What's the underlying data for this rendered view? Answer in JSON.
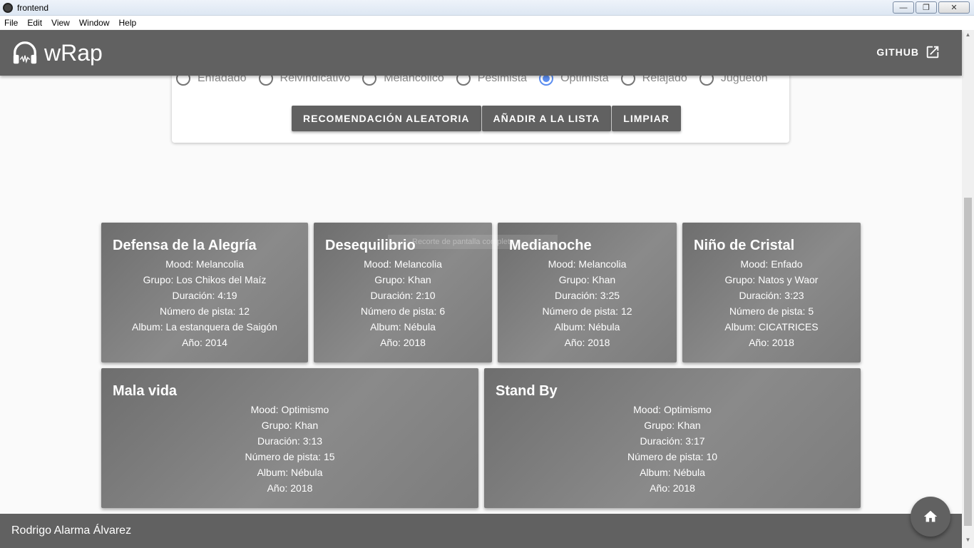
{
  "window": {
    "title": "frontend",
    "controls": [
      "minimize",
      "restore",
      "close"
    ]
  },
  "menu": [
    "File",
    "Edit",
    "View",
    "Window",
    "Help"
  ],
  "header": {
    "brand": "wRap",
    "github_label": "GITHUB"
  },
  "moods": [
    {
      "label": "Enfadado",
      "checked": false
    },
    {
      "label": "Reivindicativo",
      "checked": false
    },
    {
      "label": "Melancólico",
      "checked": false
    },
    {
      "label": "Pesimista",
      "checked": false
    },
    {
      "label": "Optimista",
      "checked": true
    },
    {
      "label": "Relajado",
      "checked": false
    },
    {
      "label": "Juguetón",
      "checked": false
    }
  ],
  "buttons": {
    "random": "RECOMENDACIÓN ALEATORIA",
    "add": "AÑADIR A LA LISTA",
    "clear": "LIMPIAR"
  },
  "songs": [
    {
      "title": "Defensa de la Alegría",
      "mood": "Mood: Melancolia",
      "group": "Grupo: Los Chikos del Maíz",
      "duration": "Duración: 4:19",
      "track": "Número de pista: 12",
      "album": "Album: La estanquera de Saigón",
      "year": "Año: 2014"
    },
    {
      "title": "Desequilibrio",
      "mood": "Mood: Melancolia",
      "group": "Grupo: Khan",
      "duration": "Duración: 2:10",
      "track": "Número de pista: 6",
      "album": "Album: Nébula",
      "year": "Año: 2018"
    },
    {
      "title": "Medianoche",
      "mood": "Mood: Melancolia",
      "group": "Grupo: Khan",
      "duration": "Duración: 3:25",
      "track": "Número de pista: 12",
      "album": "Album: Nébula",
      "year": "Año: 2018"
    },
    {
      "title": "Niño de Cristal",
      "mood": "Mood: Enfado",
      "group": "Grupo: Natos y Waor",
      "duration": "Duración: 3:23",
      "track": "Número de pista: 5",
      "album": "Album: CICATRICES",
      "year": "Año: 2018"
    },
    {
      "title": "Mala vida",
      "mood": "Mood: Optimismo",
      "group": "Grupo: Khan",
      "duration": "Duración: 3:13",
      "track": "Número de pista: 15",
      "album": "Album: Nébula",
      "year": "Año: 2018"
    },
    {
      "title": "Stand By",
      "mood": "Mood: Optimismo",
      "group": "Grupo: Khan",
      "duration": "Duración: 3:17",
      "track": "Número de pista: 10",
      "album": "Album: Nébula",
      "year": "Año: 2018"
    }
  ],
  "overlay_text": "Recorte de pantalla completa",
  "footer": {
    "author": "Rodrigo Alarma Álvarez"
  },
  "colors": {
    "appbar": "#616161",
    "radio_checked": "#5b8def",
    "background": "#fafafa"
  }
}
